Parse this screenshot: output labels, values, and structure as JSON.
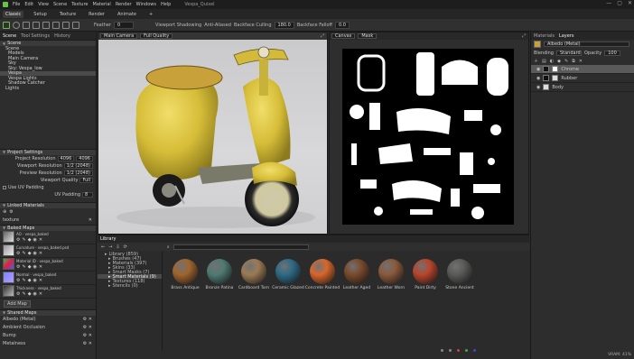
{
  "titlebar": {
    "menus": [
      "File",
      "Edit",
      "View",
      "Scene",
      "Texture",
      "Material",
      "Render",
      "Windows",
      "Help"
    ],
    "title": "Vespa_Quixel",
    "min": "—",
    "max": "▢",
    "close": "✕"
  },
  "modes": [
    "Classic",
    "Setup",
    "Texture",
    "Render",
    "Animate",
    "+"
  ],
  "toolbar": {
    "feather_label": "Feather",
    "feather_value": "0",
    "shading_label": "Viewport Shadowing",
    "antialias_label": "Anti-Aliased",
    "backface_label": "Backface Culling",
    "backface_value": "180.0",
    "falloff_label": "Backface Falloff",
    "falloff_value": "0.0"
  },
  "left": {
    "tabs": [
      "Scene",
      "Tool Settings",
      "History"
    ],
    "scene_header": "Scene",
    "scene_items": [
      "Scene",
      "Models",
      "Main Camera",
      "Sky",
      "Sky: Vespa_low",
      "Vespa",
      "Vespa Lights",
      "Shadow Catcher",
      "Lights"
    ],
    "project_header": "Project Settings",
    "project_resolution_label": "Project Resolution",
    "project_resolution_value": "4096",
    "project_resolution_value2": "4096",
    "viewport_resolution_label": "Viewport Resolution",
    "viewport_resolution_value": "1/2 (2048)",
    "preview_resolution_label": "Preview Resolution",
    "preview_resolution_value": "1/2 (2048)",
    "viewport_quality_label": "Viewport Quality",
    "viewport_quality_value": "Full",
    "use_uv_label": "Use UV Padding",
    "uv_padding_label": "UV Padding",
    "uv_padding_value": "8",
    "linked_header": "Linked Materials",
    "texture_label": "texture",
    "baked_header": "Baked Maps",
    "maps": [
      {
        "name": "AO",
        "file": "vespa_baked"
      },
      {
        "name": "Curvature",
        "file": "vespa_baked.psd"
      },
      {
        "name": "Material ID",
        "file": "vespa_baked"
      },
      {
        "name": "Normal",
        "file": "vespa_baked"
      },
      {
        "name": "Thickness",
        "file": "vespa_baked"
      }
    ],
    "add_map": "Add Map",
    "channels_header": "Shared Maps",
    "channels": [
      "Albedo (Metal)",
      "Ambient Occlusion",
      "Bump",
      "Metalness"
    ]
  },
  "viewport3d": {
    "camera": "Main Camera",
    "quality": "Full Quality"
  },
  "viewport2d": {
    "camera": "Canvas",
    "channel": "Mask"
  },
  "library": {
    "tab": "Library",
    "search_value": "",
    "tree": [
      "Library (859)",
      "Brushes (47)",
      "Materials (397)",
      "Skins (33)",
      "Smart Masks (7)",
      "Smart Materials (9)",
      "Textures (118)",
      "Stencils (0)"
    ],
    "materials": [
      {
        "name": "Brass Antique",
        "color": "#a0652e"
      },
      {
        "name": "Bronze Patina",
        "color": "#4f7a72"
      },
      {
        "name": "Cardboard Torn",
        "color": "#9c7b55"
      },
      {
        "name": "Ceramic Glazed",
        "color": "#2e6a86"
      },
      {
        "name": "Concrete Painted",
        "color": "#d8672c"
      },
      {
        "name": "Leather Aged",
        "color": "#7a4a2c"
      },
      {
        "name": "Leather Worn",
        "color": "#8a5a3c"
      },
      {
        "name": "Paint Dirty",
        "color": "#b8452c"
      },
      {
        "name": "Stone Ancient",
        "color": "#5a5a58"
      }
    ]
  },
  "right": {
    "tabs": [
      "Materials",
      "Layers"
    ],
    "material_name": "Albedo (Metal)",
    "blending_label": "Blending",
    "blending_value": "Standard",
    "opacity_label": "Opacity",
    "opacity_value": "100",
    "layers": [
      "Chrome",
      "Rubber",
      "Body"
    ],
    "status": "VRAM: 41%"
  },
  "colors": {
    "accent": "#6bbf4b",
    "panel": "#2d2d2d",
    "scooter": "#d8c23a"
  }
}
